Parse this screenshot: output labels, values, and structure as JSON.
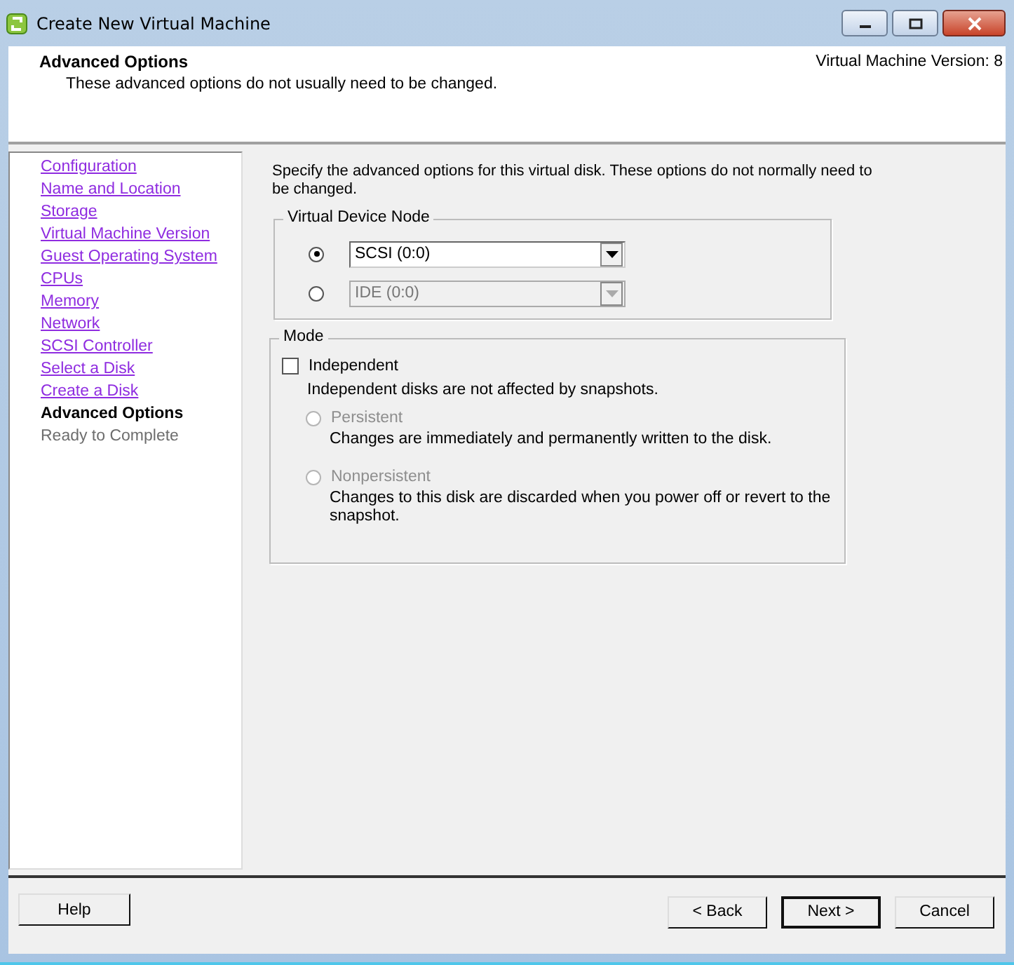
{
  "window": {
    "title": "Create New Virtual Machine"
  },
  "header": {
    "title": "Advanced Options",
    "subtitle": "These advanced options do not usually need to be changed.",
    "version": "Virtual Machine Version: 8"
  },
  "steps": [
    {
      "label": "Configuration",
      "kind": "visited"
    },
    {
      "label": "Name and Location",
      "kind": "visited"
    },
    {
      "label": "Storage",
      "kind": "visited"
    },
    {
      "label": "Virtual Machine Version",
      "kind": "visited"
    },
    {
      "label": "Guest Operating System",
      "kind": "visited"
    },
    {
      "label": "CPUs",
      "kind": "visited"
    },
    {
      "label": "Memory",
      "kind": "visited"
    },
    {
      "label": "Network",
      "kind": "visited"
    },
    {
      "label": "SCSI Controller",
      "kind": "visited"
    },
    {
      "label": "Select a Disk",
      "kind": "visited"
    },
    {
      "label": "Create a Disk",
      "kind": "visited"
    },
    {
      "label": "Advanced Options",
      "kind": "current"
    },
    {
      "label": "Ready to Complete",
      "kind": "upcoming"
    }
  ],
  "intro": "Specify the advanced options for this virtual disk. These options do not normally need to be changed.",
  "device_node": {
    "legend": "Virtual Device Node",
    "options": [
      {
        "value": "SCSI (0:0)",
        "selected": true,
        "disabled": false
      },
      {
        "value": "IDE (0:0)",
        "selected": false,
        "disabled": true
      }
    ]
  },
  "mode": {
    "legend": "Mode",
    "independent": {
      "label": "Independent",
      "checked": false
    },
    "note": "Independent disks are not affected by snapshots.",
    "options": [
      {
        "label": "Persistent",
        "selected": false,
        "disabled": true,
        "description": "Changes are immediately and permanently written to the disk."
      },
      {
        "label": "Nonpersistent",
        "selected": false,
        "disabled": true,
        "description": "Changes to this disk are discarded when you power off or revert to the snapshot."
      }
    ]
  },
  "footer": {
    "help": "Help",
    "buttons": [
      {
        "label": "< Back",
        "default": false
      },
      {
        "label": "Next >",
        "default": true
      },
      {
        "label": "Cancel",
        "default": false
      }
    ]
  }
}
